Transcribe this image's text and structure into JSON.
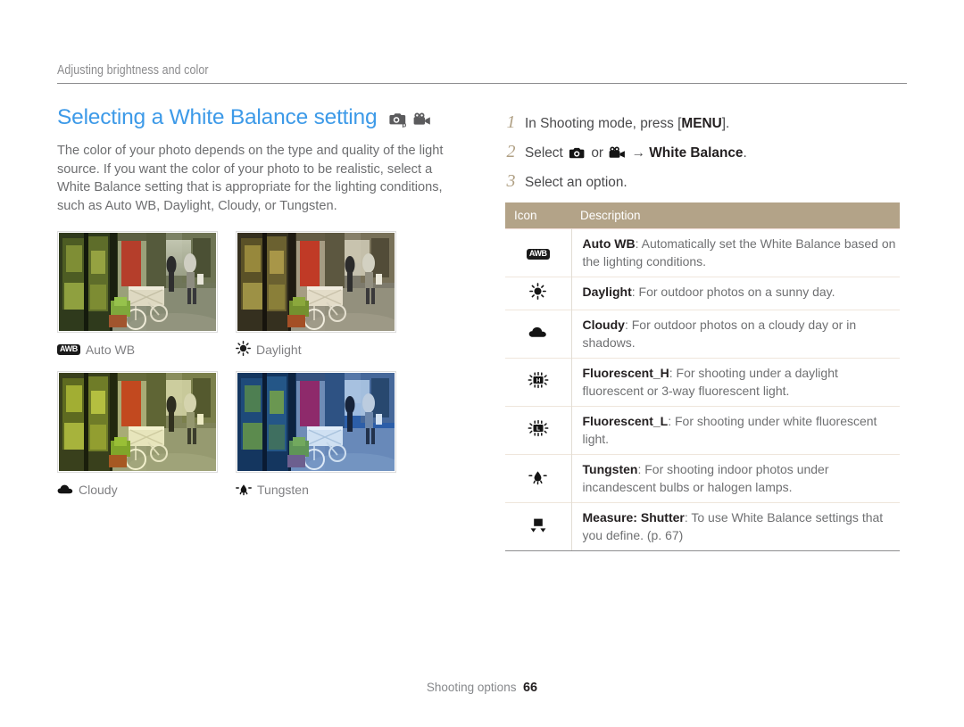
{
  "breadcrumb": "Adjusting brightness and color",
  "page": {
    "title": "Selecting a White Balance setting",
    "intro": "The color of your photo depends on the type and quality of the light source. If you want the color of your photo to be realistic, select a White Balance setting that is appropriate for the lighting conditions, such as Auto WB, Daylight, Cloudy, or Tungsten.",
    "mode_icons": [
      "camera-program-mode-icon",
      "video-mode-icon"
    ],
    "title_color": "#3d9ae8"
  },
  "samples": [
    {
      "caption": "Auto WB",
      "icon": "awb-icon",
      "tone": "auto-wb"
    },
    {
      "caption": "Daylight",
      "icon": "sun-icon",
      "tone": "daylight"
    },
    {
      "caption": "Cloudy",
      "icon": "cloud-icon",
      "tone": "cloudy"
    },
    {
      "caption": "Tungsten",
      "icon": "tungsten-icon",
      "tone": "tungsten"
    }
  ],
  "steps": [
    {
      "num": "1",
      "pre": "In Shooting mode, press [",
      "bold": "MENU",
      "post": "]."
    },
    {
      "num": "2",
      "pre": "Select ",
      "mid": " or ",
      "arrow": " → ",
      "bold": "White Balance",
      "post": "."
    },
    {
      "num": "3",
      "pre": "Select an option.",
      "bold": "",
      "post": ""
    }
  ],
  "table": {
    "headers": {
      "icon": "Icon",
      "description": "Description"
    },
    "header_bg": "#b3a388",
    "rows": [
      {
        "icon": "awb-icon",
        "label": "Auto WB",
        "desc": ": Automatically set the White Balance based on the lighting conditions."
      },
      {
        "icon": "sun-icon",
        "label": "Daylight",
        "desc": ": For outdoor photos on a sunny day."
      },
      {
        "icon": "cloud-icon",
        "label": "Cloudy",
        "desc": ": For outdoor photos on a cloudy day or in shadows."
      },
      {
        "icon": "fluorescent-h-icon",
        "label": "Fluorescent_H",
        "desc": ": For shooting under a daylight fluorescent or 3-way fluorescent light."
      },
      {
        "icon": "fluorescent-l-icon",
        "label": "Fluorescent_L",
        "desc": ": For shooting under white fluorescent light."
      },
      {
        "icon": "tungsten-icon",
        "label": "Tungsten",
        "desc": ": For shooting indoor photos under incandescent bulbs or halogen lamps."
      },
      {
        "icon": "measure-shutter-icon",
        "label": "Measure: Shutter",
        "desc": ": To use White Balance settings that you define. (p. 67)"
      }
    ]
  },
  "footer": {
    "section": "Shooting options",
    "page_number": "66"
  }
}
